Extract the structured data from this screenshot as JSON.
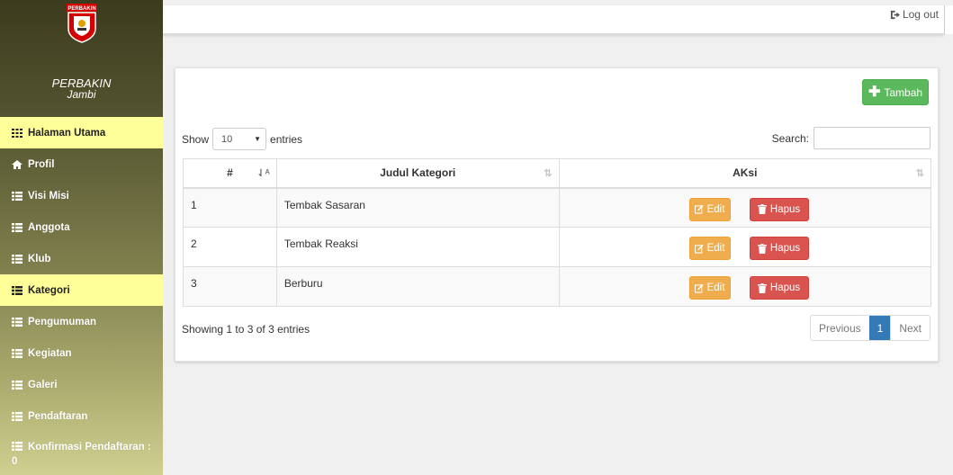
{
  "sidebar": {
    "logo_text": "PERBAKIN",
    "brand_name": "PERBAKIN",
    "brand_region": "Jambi",
    "items": [
      {
        "label": "Halaman Utama",
        "icon": "grid-icon",
        "active": true
      },
      {
        "label": "Profil",
        "icon": "home-icon",
        "active": false
      },
      {
        "label": "Visi Misi",
        "icon": "list-icon",
        "active": false
      },
      {
        "label": "Anggota",
        "icon": "list-icon",
        "active": false
      },
      {
        "label": "Klub",
        "icon": "list-icon",
        "active": false
      },
      {
        "label": "Kategori",
        "icon": "list-icon",
        "active": true
      },
      {
        "label": "Pengumuman",
        "icon": "list-icon",
        "active": false
      },
      {
        "label": "Kegiatan",
        "icon": "list-icon",
        "active": false
      },
      {
        "label": "Galeri",
        "icon": "list-icon",
        "active": false
      },
      {
        "label": "Pendaftaran",
        "icon": "list-icon",
        "active": false
      },
      {
        "label": "Konfirmasi Pendaftaran :",
        "count": "0",
        "icon": "list-icon",
        "active": false
      }
    ]
  },
  "topbar": {
    "logout_label": "Log out"
  },
  "panel": {
    "add_button_label": "Tambah",
    "show_label": "Show",
    "entries_value": "10",
    "entries_label": "entries",
    "search_label": "Search:",
    "search_value": "",
    "table": {
      "headers": [
        "#",
        "Judul Kategori",
        "AKsi"
      ],
      "rows": [
        {
          "no": "1",
          "judul": "Tembak Sasaran"
        },
        {
          "no": "2",
          "judul": "Tembak Reaksi"
        },
        {
          "no": "3",
          "judul": "Berburu"
        }
      ],
      "edit_label": "Edit",
      "delete_label": "Hapus"
    },
    "info_text": "Showing 1 to 3 of 3 entries",
    "pagination": {
      "previous": "Previous",
      "current": "1",
      "next": "Next"
    }
  },
  "colors": {
    "active_menu": "#ffff99",
    "add_button": "#5cb85c",
    "edit_button": "#f0ad4e",
    "delete_button": "#d9534f",
    "pagination_active": "#337ab7"
  }
}
